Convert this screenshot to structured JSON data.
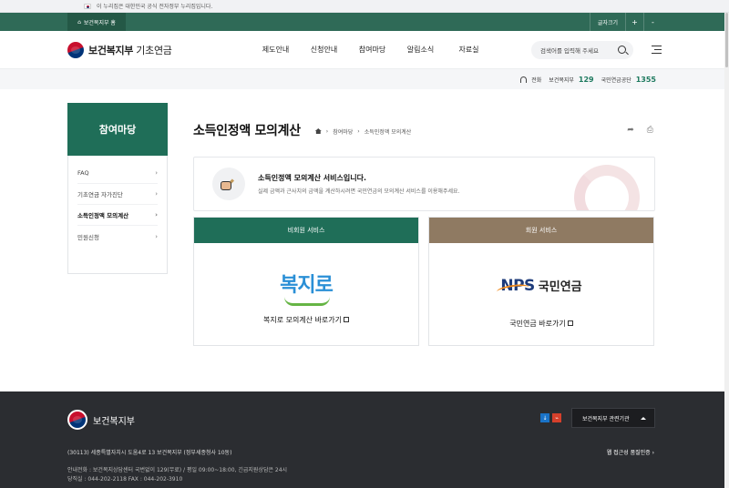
{
  "gov_banner": {
    "text": "이 누리집은 대한민국 공식 전자정부 누리집입니다."
  },
  "topbar": {
    "home_label": "보건복지부 홈",
    "font_size_label": "글자크기",
    "plus": "+",
    "minus": "-"
  },
  "header": {
    "logo_bold": "보건복지부",
    "logo_light": " 기초연금",
    "nav": [
      "제도안내",
      "신청안내",
      "참여마당",
      "알림소식",
      "자료실"
    ],
    "search_placeholder": "검색어를 입력해 주세요"
  },
  "contact": {
    "label": "전화",
    "items": [
      {
        "name": "보건복지부",
        "number": "129"
      },
      {
        "name": "국민연금공단",
        "number": "1355"
      }
    ]
  },
  "sidebar": {
    "title": "참여마당",
    "items": [
      {
        "label": "FAQ",
        "active": false
      },
      {
        "label": "기초연금 자가진단",
        "active": false
      },
      {
        "label": "소득인정액 모의계산",
        "active": true
      },
      {
        "label": "민원신청",
        "active": false
      }
    ]
  },
  "page": {
    "title": "소득인정액 모의계산",
    "breadcrumb": [
      "참여마당",
      "소득인정액 모의계산"
    ],
    "intro_title": "소득인정액 모의계산 서비스입니다.",
    "intro_desc": "실제 금액과 근사치의 금액을 계산하시려면 국민연금의 모의계산 서비스를 이용해주세요."
  },
  "cards": [
    {
      "header": "비회원 서비스",
      "logo_text": "복지로",
      "link": "복지로 모의계산 바로가기"
    },
    {
      "header": "회원 서비스",
      "logo_text_en": "NPS",
      "logo_text_ko": "국민연금",
      "link": "국민연금 바로가기"
    }
  ],
  "footer": {
    "org": "보건복지부",
    "related_select": "보건복지부 관련기관",
    "address": "(30113) 세종특별자치시 도움4로 13 보건복지부 (정부세종청사 10동)",
    "web_cert": "웹 접근성 품질인증",
    "info_line1": "안내전화 : 보건복지상담센터 국번없이 129(무료) / 평일 09:00~18:00, 긴급지원상담은 24시",
    "info_line2": "당직실 : 044-202-2118    FAX : 044-202-3910"
  }
}
